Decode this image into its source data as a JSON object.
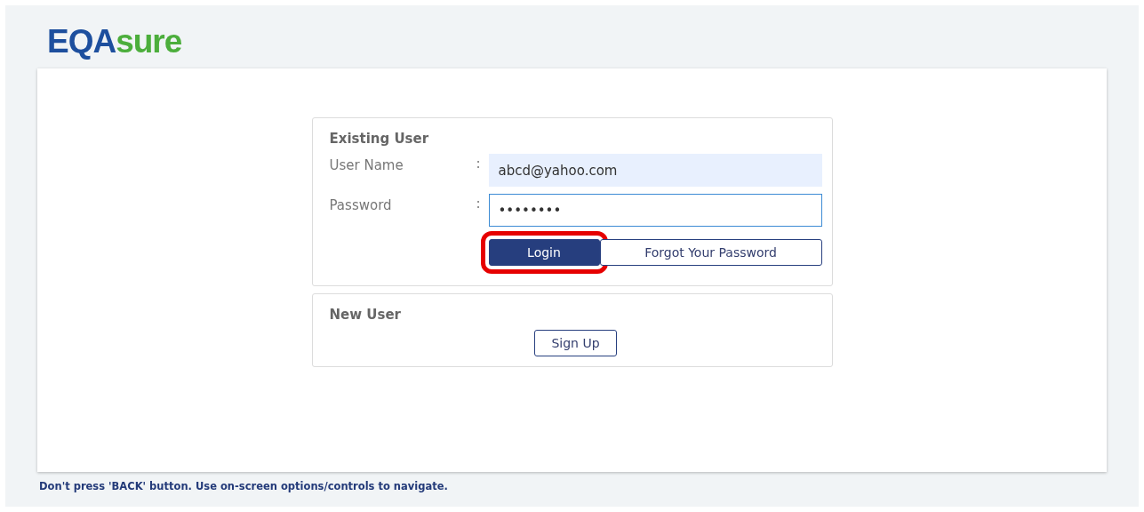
{
  "logo": {
    "parts": [
      {
        "text": "EQA",
        "color": "#1d4f9e"
      },
      {
        "text": "sure",
        "color": "#4cae3c"
      }
    ]
  },
  "existing_user": {
    "title": "Existing User",
    "fields": [
      {
        "label": "User Name",
        "separator": ":",
        "value": "abcd@yahoo.com",
        "autofilled": true,
        "focused": false
      },
      {
        "label": "Password",
        "separator": ":",
        "value": "••••••••",
        "autofilled": false,
        "focused": true
      }
    ],
    "buttons": [
      {
        "label": "Login",
        "kind": "primary",
        "highlighted": true
      },
      {
        "label": "Forgot Your Password",
        "kind": "outline",
        "highlighted": false
      }
    ]
  },
  "new_user": {
    "title": "New User",
    "button": {
      "label": "Sign Up",
      "kind": "outline"
    }
  },
  "footer_note": "Don't press 'BACK' button. Use on-screen options/controls to navigate."
}
